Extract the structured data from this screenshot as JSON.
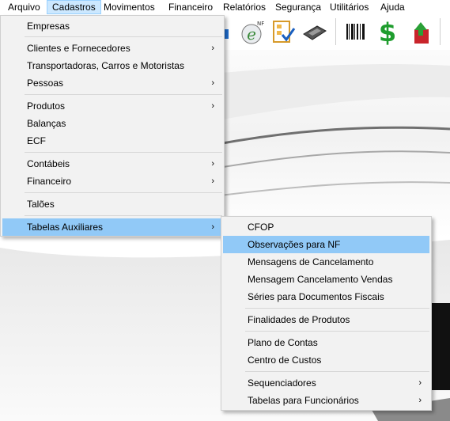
{
  "menubar": {
    "items": [
      "Arquivo",
      "Cadastros",
      "Movimentos",
      "Financeiro",
      "Relatórios",
      "Segurança",
      "Utilitários",
      "Ajuda"
    ],
    "active": "Cadastros"
  },
  "toolbar": {
    "icons": [
      "nfe-icon",
      "checklist-icon",
      "keypad-icon",
      "barcode-icon",
      "dollar-icon",
      "upload-icon"
    ],
    "nfe_text": "NF"
  },
  "cadastros_menu": {
    "items": [
      {
        "label": "Empresas",
        "submenu": false
      },
      {
        "label": "Clientes e Fornecedores",
        "submenu": true
      },
      {
        "label": "Transportadoras, Carros e Motoristas",
        "submenu": false
      },
      {
        "label": "Pessoas",
        "submenu": true
      },
      {
        "label": "Produtos",
        "submenu": true
      },
      {
        "label": "Balanças",
        "submenu": false
      },
      {
        "label": "ECF",
        "submenu": false
      },
      {
        "label": "Contábeis",
        "submenu": true
      },
      {
        "label": "Financeiro",
        "submenu": true
      },
      {
        "label": "Talões",
        "submenu": false
      },
      {
        "label": "Tabelas Auxiliares",
        "submenu": true,
        "highlighted": true
      }
    ]
  },
  "tabelas_submenu": {
    "items": [
      {
        "label": "CFOP",
        "submenu": false
      },
      {
        "label": "Observações para NF",
        "submenu": false,
        "highlighted": true
      },
      {
        "label": "Mensagens de Cancelamento",
        "submenu": false
      },
      {
        "label": "Mensagem Cancelamento Vendas",
        "submenu": false
      },
      {
        "label": "Séries para Documentos Fiscais",
        "submenu": false
      },
      {
        "label": "Finalidades de Produtos",
        "submenu": false
      },
      {
        "label": "Plano de Contas",
        "submenu": false
      },
      {
        "label": "Centro de Custos",
        "submenu": false
      },
      {
        "label": "Sequenciadores",
        "submenu": true
      },
      {
        "label": "Tabelas para Funcionários",
        "submenu": true
      }
    ]
  },
  "arrow_glyph": "›",
  "colors": {
    "highlight": "#91c9f7",
    "menubar_active": "#cce8ff",
    "menu_bg": "#f2f2f2"
  }
}
